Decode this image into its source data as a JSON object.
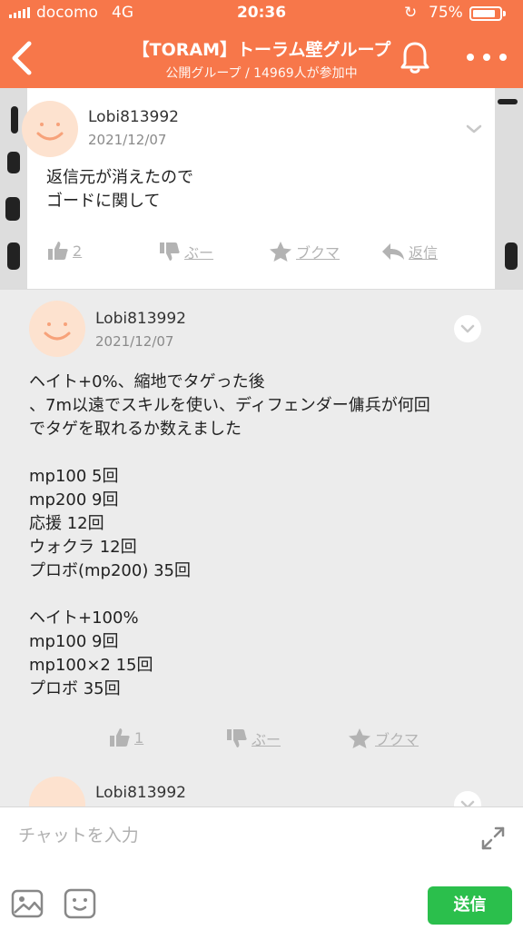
{
  "status_bar": {
    "carrier": "docomo",
    "network": "4G",
    "time": "20:36",
    "battery": "75%",
    "battery_level": 0.75
  },
  "header": {
    "title": "【TORAM】トーラム壁グループ",
    "subtitle": "公開グループ / 14969人が参加中",
    "accent_color": "#f7774a"
  },
  "messages": [
    {
      "username": "Lobi813992",
      "date": "2021/12/07",
      "text": "返信元が消えたので\nゴードに関して",
      "like_count": "2",
      "boo_label": "ぶー",
      "bookmark_label": "ブクマ",
      "reply_label": "返信"
    },
    {
      "username": "Lobi813992",
      "date": "2021/12/07",
      "text": "ヘイト+0%、縮地でタゲった後\n、7m以遠でスキルを使い、ディフェンダー傭兵が何回\nでタゲを取れるか数えました\n\nmp100 5回\nmp200 9回\n応援 12回\nウォクラ 12回\nプロボ(mp200) 35回\n\nヘイト+100%\nmp100 9回\nmp100×2 15回\nプロボ 35回",
      "like_count": "1",
      "boo_label": "ぶー",
      "bookmark_label": "ブクマ"
    },
    {
      "username": "Lobi813992"
    }
  ],
  "input": {
    "placeholder": "チャットを入力",
    "send_label": "送信",
    "send_color": "#2bbf4c"
  },
  "icons": [
    "back-icon",
    "bell-icon",
    "more-icon",
    "thumb-up-icon",
    "thumb-down-icon",
    "star-icon",
    "reply-icon",
    "chevron-down-icon",
    "expand-icon",
    "image-icon",
    "emoji-icon"
  ]
}
